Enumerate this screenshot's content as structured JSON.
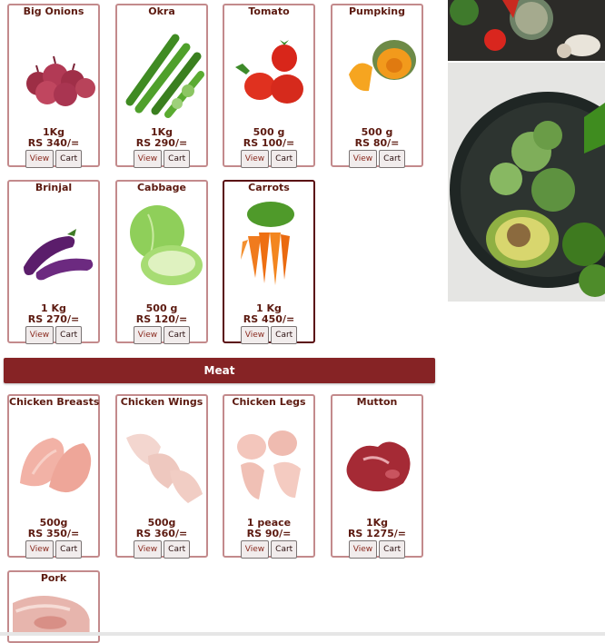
{
  "vegetables": [
    {
      "name": "Big Onions",
      "qty": "1Kg",
      "price": "RS 340/=",
      "view": "View",
      "cart": "Cart"
    },
    {
      "name": "Okra",
      "qty": "1Kg",
      "price": "RS 290/=",
      "view": "View",
      "cart": "Cart"
    },
    {
      "name": "Tomato",
      "qty": "500 g",
      "price": "RS 100/=",
      "view": "View",
      "cart": "Cart"
    },
    {
      "name": "Pumpking",
      "qty": "500 g",
      "price": "RS 80/=",
      "view": "View",
      "cart": "Cart"
    },
    {
      "name": "Brinjal",
      "qty": "1 Kg",
      "price": "RS 270/=",
      "view": "View",
      "cart": "Cart"
    },
    {
      "name": "Cabbage",
      "qty": "500 g",
      "price": "RS 120/=",
      "view": "View",
      "cart": "Cart"
    },
    {
      "name": "Carrots",
      "qty": "1 Kg",
      "price": "RS 450/=",
      "view": "View",
      "cart": "Cart"
    }
  ],
  "meat_section": {
    "title": "Meat"
  },
  "meat": [
    {
      "name": "Chicken Breasts",
      "qty": "500g",
      "price": "RS 350/=",
      "view": "View",
      "cart": "Cart"
    },
    {
      "name": "Chicken Wings",
      "qty": "500g",
      "price": "RS 360/=",
      "view": "View",
      "cart": "Cart"
    },
    {
      "name": "Chicken Legs",
      "qty": "1 peace",
      "price": "RS 90/=",
      "view": "View",
      "cart": "Cart"
    },
    {
      "name": "Mutton",
      "qty": "1Kg",
      "price": "RS 1275/=",
      "view": "View",
      "cart": "Cart"
    },
    {
      "name": "Pork"
    }
  ]
}
